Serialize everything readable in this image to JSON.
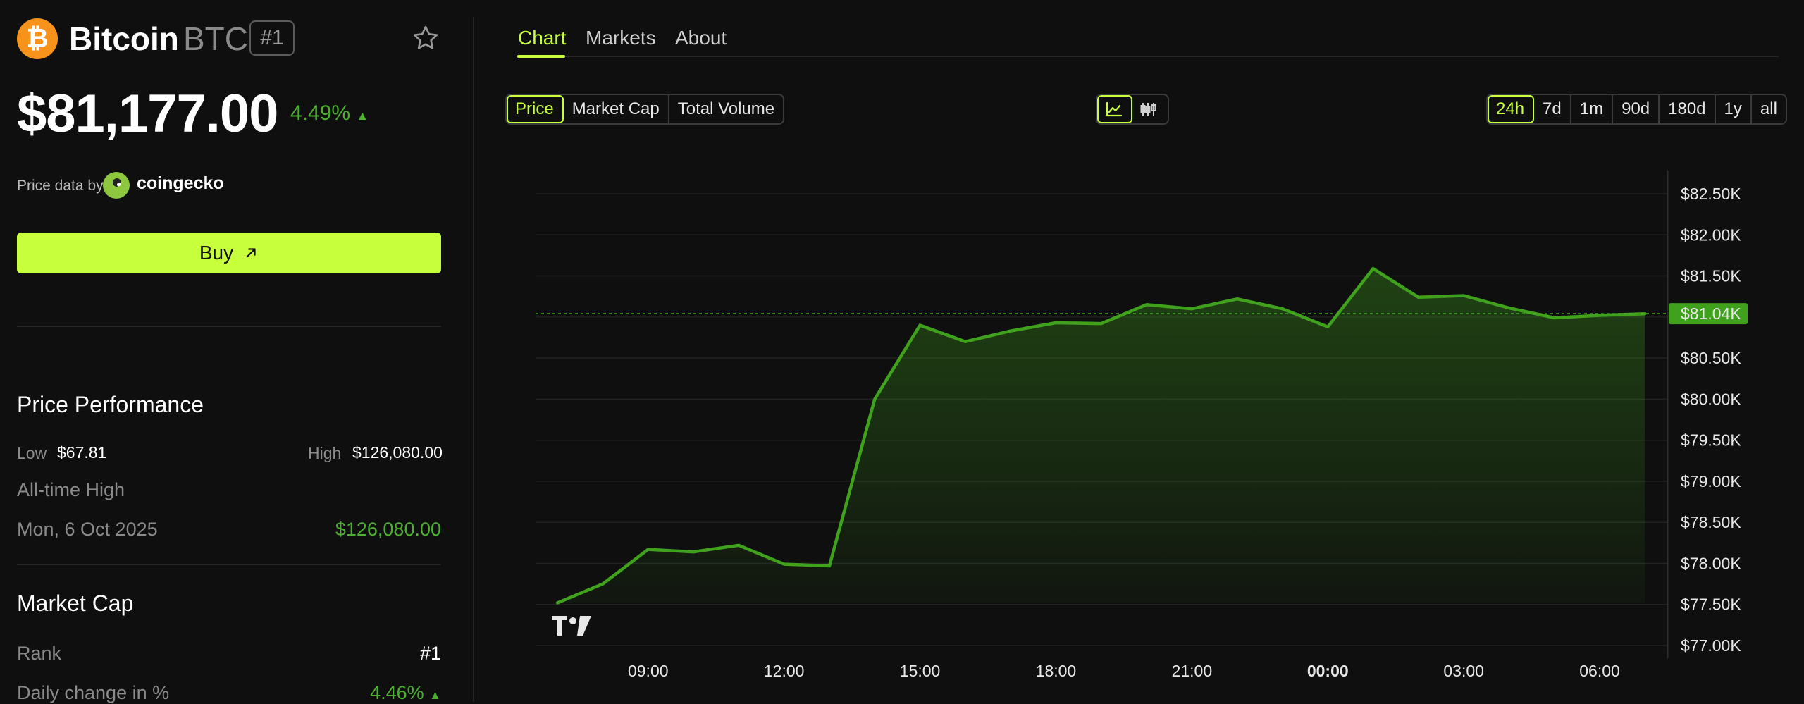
{
  "coin": {
    "logo_glyph": "₿",
    "name": "Bitcoin",
    "symbol": "BTC",
    "rank_badge": "#1",
    "price": "$81,177.00",
    "change": "4.49%",
    "change_arrow": "▲"
  },
  "price_source": {
    "label": "Price data by",
    "provider": "coingecko"
  },
  "buy": {
    "label": "Buy"
  },
  "performance": {
    "title": "Price Performance",
    "low_label": "Low",
    "low_value": "$67.81",
    "high_label": "High",
    "high_value": "$126,080.00",
    "ath_label": "All-time High",
    "ath_date": "Mon, 6 Oct 2025",
    "ath_value": "$126,080.00"
  },
  "market_cap": {
    "title": "Market Cap",
    "rank_label": "Rank",
    "rank_value": "#1",
    "daily_change_label": "Daily change in %",
    "daily_change_value": "4.46%",
    "daily_change_arrow": "▲"
  },
  "tabs": [
    {
      "label": "Chart",
      "active": true
    },
    {
      "label": "Markets",
      "active": false
    },
    {
      "label": "About",
      "active": false
    }
  ],
  "metric_toggle": [
    "Price",
    "Market Cap",
    "Total Volume"
  ],
  "metric_active": "Price",
  "chart_type_toggle": [
    "line-chart-icon",
    "candlestick-icon"
  ],
  "range_toggle": [
    "24h",
    "7d",
    "1m",
    "90d",
    "180d",
    "1y",
    "all"
  ],
  "range_active": "24h",
  "colors": {
    "accent": "#c8ff3d",
    "up": "#4caf2f",
    "line": "#3fa11c",
    "background": "#0f0f0f"
  },
  "chart_data": {
    "type": "area",
    "x_labels": [
      "09:00",
      "12:00",
      "15:00",
      "18:00",
      "21:00",
      "00:00",
      "03:00",
      "06:00"
    ],
    "x_label_bold": "00:00",
    "y_ticks": [
      "$82.50K",
      "$82.00K",
      "$81.50K",
      "$81.00K",
      "$80.50K",
      "$80.00K",
      "$79.50K",
      "$79.00K",
      "$78.50K",
      "$78.00K",
      "$77.50K",
      "$77.00K"
    ],
    "ylim": [
      77000,
      82750
    ],
    "x_hours_range": [
      6.5,
      31.0
    ],
    "current_price_label": "$81.04K",
    "current_price": 81040,
    "grid": true,
    "watermark": "TV",
    "series": [
      {
        "values": [
          [
            7.0,
            77520
          ],
          [
            8.0,
            77750
          ],
          [
            9.0,
            78170
          ],
          [
            10.0,
            78140
          ],
          [
            11.0,
            78220
          ],
          [
            12.0,
            77990
          ],
          [
            13.0,
            77970
          ],
          [
            14.0,
            80000
          ],
          [
            15.0,
            80900
          ],
          [
            16.0,
            80700
          ],
          [
            17.0,
            80830
          ],
          [
            18.0,
            80930
          ],
          [
            19.0,
            80920
          ],
          [
            20.0,
            81150
          ],
          [
            21.0,
            81100
          ],
          [
            22.0,
            81220
          ],
          [
            23.0,
            81100
          ],
          [
            24.0,
            80880
          ],
          [
            25.0,
            81590
          ],
          [
            26.0,
            81240
          ],
          [
            27.0,
            81260
          ],
          [
            28.0,
            81110
          ],
          [
            29.0,
            80990
          ],
          [
            30.0,
            81020
          ],
          [
            31.0,
            81040
          ]
        ]
      }
    ]
  }
}
